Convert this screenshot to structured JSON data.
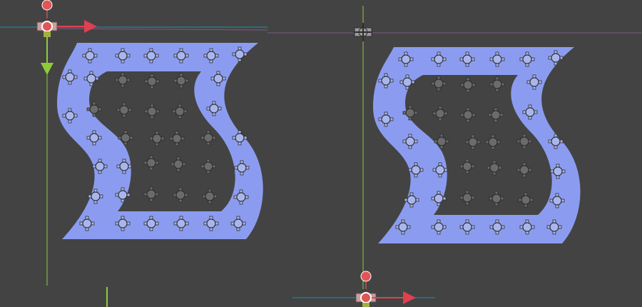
{
  "app": {
    "title": "",
    "background": "#434343"
  },
  "colors": {
    "shape_fill": "#8b9cf0",
    "hole_fill": "#434343",
    "point_fill_outer": "#a9b6ee",
    "point_fill_inner": "#6b6b6b",
    "point_stroke": "#2e2e2e",
    "handle_red": "#e05555",
    "axis_x": "#e0404f",
    "axis_y": "#8ecb3a",
    "guide_line": "#7a5a8a"
  },
  "left_panel": {
    "label": "collision-shape-left",
    "gizmo": "transform-gizmo-active"
  },
  "right_panel": {
    "label": "collision-shape-right",
    "gizmo": "transform-gizmo-inactive"
  },
  "icons": {
    "vertex": "crosshair-vertex-icon",
    "rotate_handle": "rotate-handle-icon",
    "move_x": "move-x-arrow-icon",
    "move_y": "move-y-arrow-icon"
  }
}
